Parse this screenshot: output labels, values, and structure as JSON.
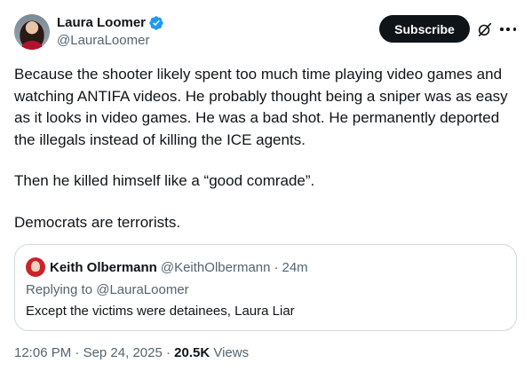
{
  "author": {
    "display_name": "Laura Loomer",
    "handle": "@LauraLoomer",
    "verified": true,
    "verified_color": "#1d9bf0"
  },
  "actions": {
    "subscribe_label": "Subscribe"
  },
  "tweet": {
    "paragraphs": [
      "Because the shooter likely spent too much time playing video games and watching ANTIFA videos. He probably thought being a sniper was as easy as it looks in video games. He was a bad shot. He permanently deported the illegals instead of killing the ICE agents.",
      "Then he killed himself like a “good comrade”.",
      "Democrats are terrorists."
    ]
  },
  "quoted": {
    "display_name": "Keith Olbermann",
    "handle": "@KeithOlbermann",
    "separator": "·",
    "time": "24m",
    "replying_to": "Replying to @LauraLoomer",
    "text": "Except the victims were detainees, Laura Liar"
  },
  "meta": {
    "time": "12:06 PM",
    "separator": "·",
    "date": "Sep 24, 2025",
    "separator2": "·",
    "views_count": "20.5K",
    "views_label": "Views"
  }
}
